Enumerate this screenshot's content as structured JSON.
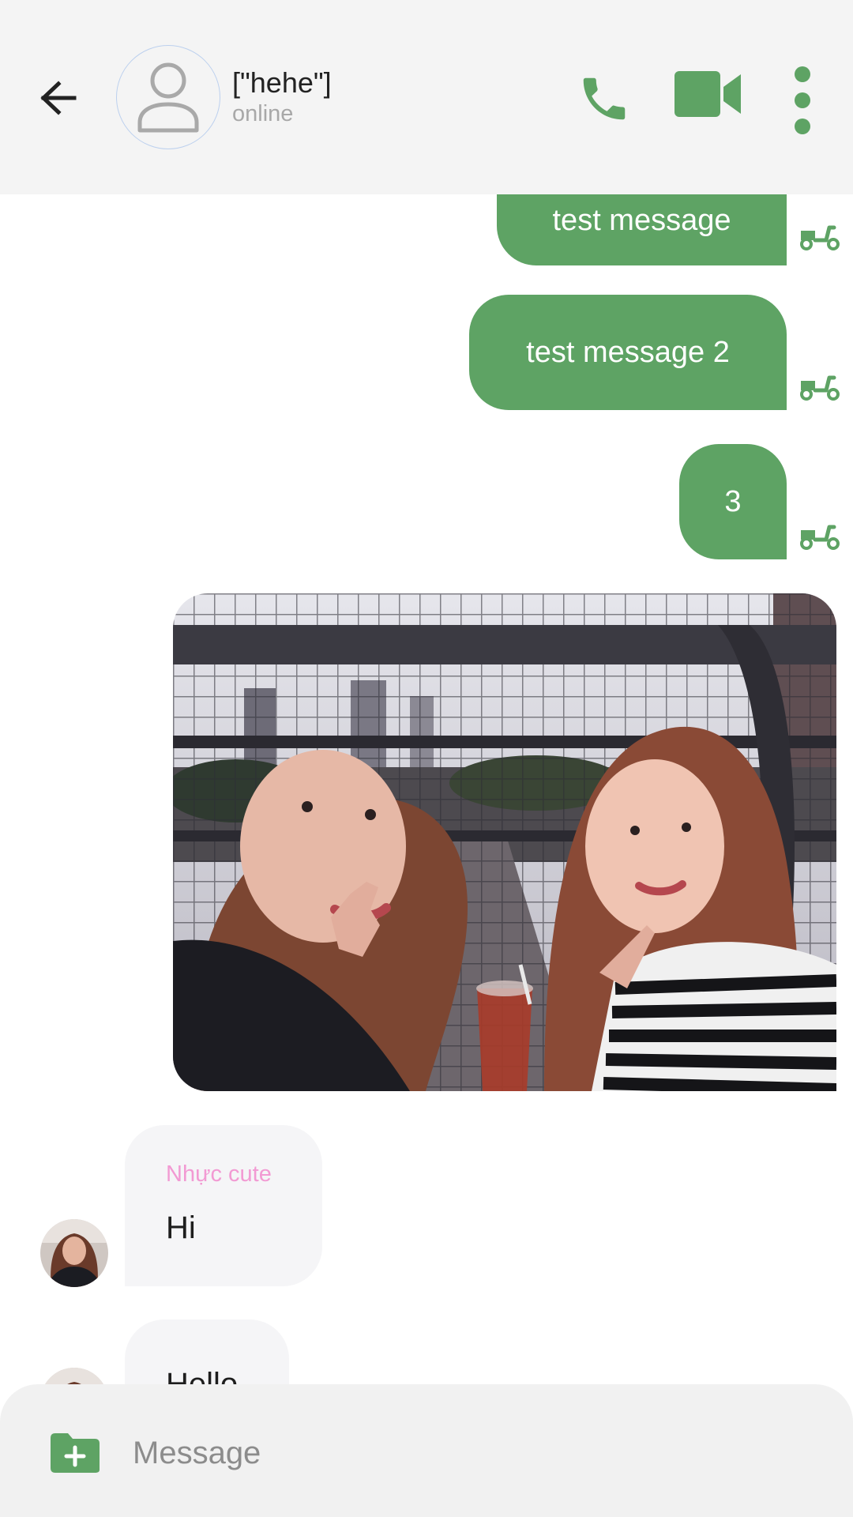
{
  "header": {
    "contact_name": "[\"hehe\"]",
    "contact_status": "online",
    "icons": {
      "back": "arrow-left-icon",
      "avatar": "person-placeholder-icon",
      "call": "phone-icon",
      "video": "video-camera-icon",
      "more": "more-vertical-icon"
    }
  },
  "messages": {
    "outgoing": [
      {
        "text": "test message",
        "status_icon": "delivered-scooter-icon"
      },
      {
        "text": "test message 2",
        "status_icon": "delivered-scooter-icon"
      },
      {
        "text": "3",
        "status_icon": "delivered-scooter-icon"
      }
    ],
    "photo": {
      "kind": "image",
      "subject": "selfie-photo"
    },
    "incoming": [
      {
        "sender": "Nhực cute",
        "text": "Hi"
      },
      {
        "text": "Hello"
      }
    ]
  },
  "composer": {
    "placeholder": "Message",
    "attach_icon": "folder-add-icon"
  },
  "colors": {
    "accent": "#5ea364",
    "header_bg": "#f4f4f4",
    "incoming_bubble": "#f5f5f7",
    "sender_name": "#f29ad3",
    "status_text": "#a8a8a8"
  }
}
